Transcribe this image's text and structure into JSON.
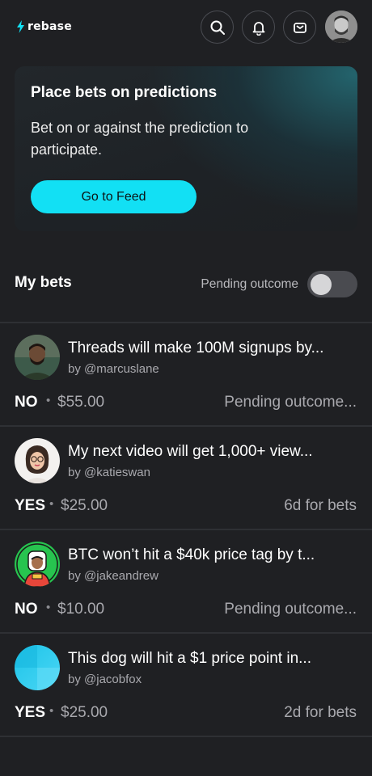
{
  "header": {
    "logo_text": "rebase",
    "icons": [
      "search-icon",
      "bell-icon",
      "mail-icon"
    ],
    "accent_color": "#12e0f4"
  },
  "banner": {
    "title": "Place bets on predictions",
    "body": "Bet on or against the prediction to participate.",
    "button_label": "Go to Feed"
  },
  "bets_section": {
    "title": "My bets",
    "toggle_label": "Pending outcome",
    "toggle_on": false
  },
  "bets": [
    {
      "title": "Threads will make 100M signups by...",
      "author": "by @marcuslane",
      "side": "NO",
      "amount": "$55.00",
      "status": "Pending outcome..."
    },
    {
      "title": "My next video will get 1,000+ view...",
      "author": "by @katieswan",
      "side": "YES",
      "amount": "$25.00",
      "status": "6d for bets"
    },
    {
      "title": "BTC won’t hit a $40k price tag by t...",
      "author": "by @jakeandrew",
      "side": "NO",
      "amount": "$10.00",
      "status": "Pending outcome..."
    },
    {
      "title": "This dog will hit a $1 price point in...",
      "author": "by @jacobfox",
      "side": "YES",
      "amount": "$25.00",
      "status": "2d for bets"
    }
  ],
  "separator": "•"
}
